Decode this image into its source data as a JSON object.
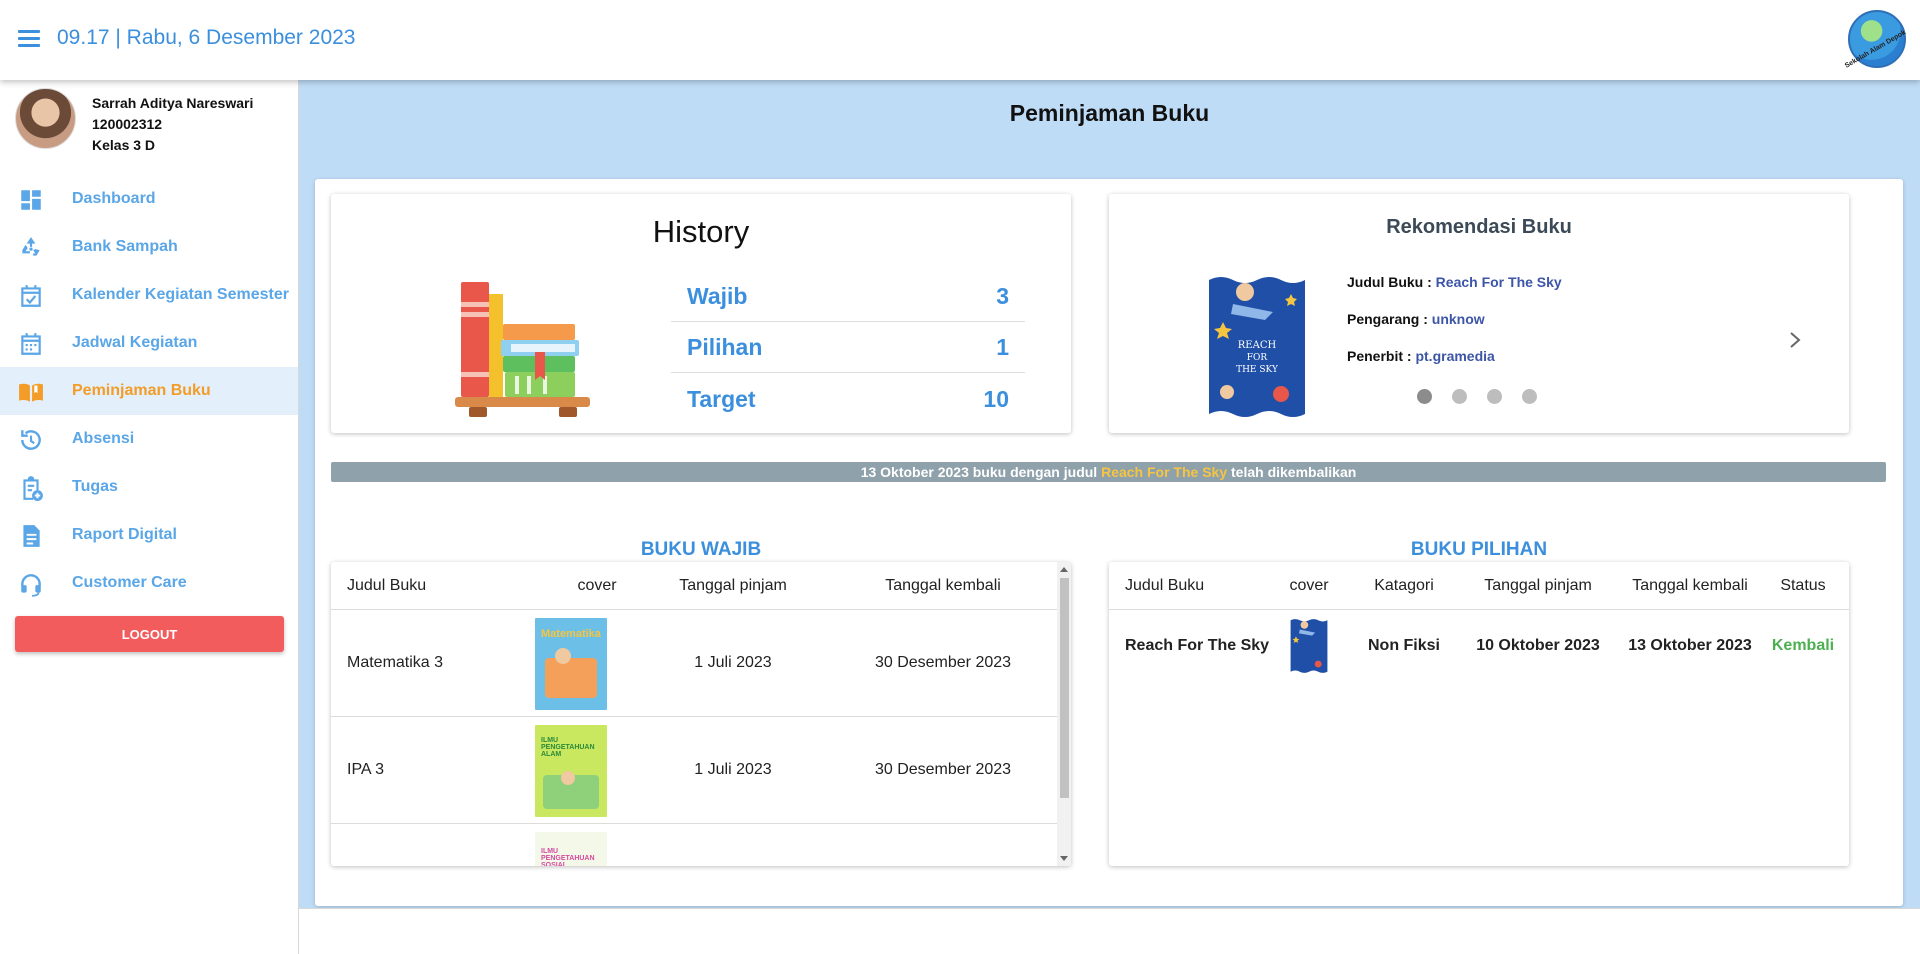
{
  "topbar": {
    "datetime": "09.17 | Rabu, 6 Desember 2023",
    "logo_text": "Sekolah Alam Depok"
  },
  "profile": {
    "name": "Sarrah Aditya Nareswari",
    "id": "120002312",
    "class": "Kelas 3 D"
  },
  "sidebar": {
    "items": [
      {
        "label": "Dashboard",
        "icon": "dashboard-icon"
      },
      {
        "label": "Bank Sampah",
        "icon": "recycle-icon"
      },
      {
        "label": "Kalender Kegiatan Semester",
        "icon": "calendar-check-icon"
      },
      {
        "label": "Jadwal Kegiatan",
        "icon": "calendar-icon"
      },
      {
        "label": "Peminjaman Buku",
        "icon": "book-open-icon",
        "active": true
      },
      {
        "label": "Absensi",
        "icon": "history-clock-icon"
      },
      {
        "label": "Tugas",
        "icon": "clipboard-add-icon"
      },
      {
        "label": "Raport Digital",
        "icon": "document-icon"
      },
      {
        "label": "Customer Care",
        "icon": "headset-icon"
      }
    ],
    "logout_label": "LOGOUT"
  },
  "main": {
    "title": "Peminjaman Buku"
  },
  "history": {
    "title": "History",
    "rows": [
      {
        "label": "Wajib",
        "value": "3"
      },
      {
        "label": "Pilihan",
        "value": "1"
      },
      {
        "label": "Target",
        "value": "10"
      }
    ]
  },
  "rekomendasi": {
    "title": "Rekomendasi Buku",
    "judul_label": "Judul Buku :",
    "judul_value": "Reach For The Sky",
    "pengarang_label": "Pengarang :",
    "pengarang_value": "unknow",
    "penerbit_label": "Penerbit :",
    "penerbit_value": "pt.gramedia",
    "slide_count": 4,
    "active_slide": 0
  },
  "banner": {
    "prefix": "13 Oktober 2023 buku dengan judul ",
    "highlight": "Reach For The Sky",
    "suffix": " telah dikembalikan"
  },
  "buku_wajib": {
    "title": "BUKU WAJIB",
    "headers": [
      "Judul Buku",
      "cover",
      "Tanggal pinjam",
      "Tanggal kembali"
    ],
    "rows": [
      {
        "judul": "Matematika 3",
        "pinjam": "1 Juli 2023",
        "kembali": "30 Desember 2023",
        "cover_title": "Matematika"
      },
      {
        "judul": "IPA 3",
        "pinjam": "1 Juli 2023",
        "kembali": "30 Desember 2023",
        "cover_title": "ILMU PENGETAHUAN ALAM"
      },
      {
        "judul": "",
        "pinjam": "",
        "kembali": "",
        "cover_title": "ILMU PENGETAHUAN SOSIAL"
      }
    ]
  },
  "buku_pilihan": {
    "title": "BUKU PILIHAN",
    "headers": [
      "Judul Buku",
      "cover",
      "Katagori",
      "Tanggal pinjam",
      "Tanggal kembali",
      "Status"
    ],
    "rows": [
      {
        "judul": "Reach For The Sky",
        "katagori": "Non Fiksi",
        "pinjam": "10 Oktober 2023",
        "kembali": "13 Oktober 2023",
        "status": "Kembali"
      }
    ]
  },
  "colors": {
    "accent": "#3b8fdc",
    "active_nav": "#f39c28",
    "logout": "#f25c5c",
    "status_ok": "#4caf50",
    "banner": "#8fa1ab",
    "banner_highlight": "#f5c542"
  }
}
